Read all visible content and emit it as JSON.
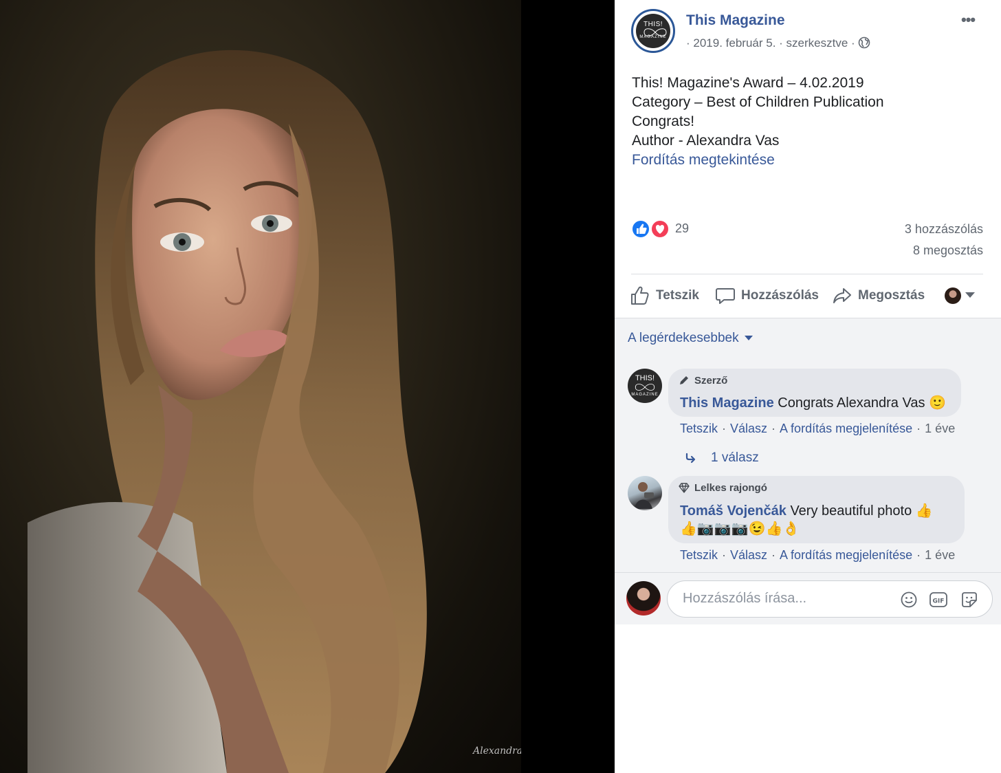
{
  "photo": {
    "watermark_text": "AlexandraVas"
  },
  "post": {
    "page_name": "This Magazine",
    "avatar_top": "THIS!",
    "avatar_bottom": "MAGAZINE",
    "date": "· 2019. február 5.",
    "edited": "· szerkesztve ·",
    "lines": [
      "This! Magazine's Award – 4.02.2019",
      "Category – Best of Children Publication",
      "Congrats!",
      "Author - Alexandra Vas"
    ],
    "see_translation": "Fordítás megtekintése",
    "reactions_count": "29",
    "comments_count": "3 hozzászólás",
    "shares_count": "8 megosztás"
  },
  "actions": {
    "like": "Tetszik",
    "comment": "Hozzászólás",
    "share": "Megosztás"
  },
  "comments": {
    "sort_label": "A legérdekesebbek",
    "items": [
      {
        "badge": "Szerző",
        "author": "This Magazine",
        "text": "Congrats Alexandra Vas 🙂",
        "like": "Tetszik",
        "reply": "Válasz",
        "translate": "A fordítás megjelenítése",
        "time": "1 éve"
      },
      {
        "badge": "Lelkes rajongó",
        "author": "Tomáš Vojenčák",
        "text": "Very beautiful photo 👍",
        "text2": "👍📷📷📷😉👍👌",
        "like": "Tetszik",
        "reply": "Válasz",
        "translate": "A fordítás megjelenítése",
        "time": "1 éve"
      }
    ],
    "reply_count": "1 válasz",
    "write_placeholder": "Hozzászólás írása..."
  },
  "colors": {
    "link": "#385898",
    "like_blue": "#1877f2",
    "love_red": "#f33e58"
  }
}
